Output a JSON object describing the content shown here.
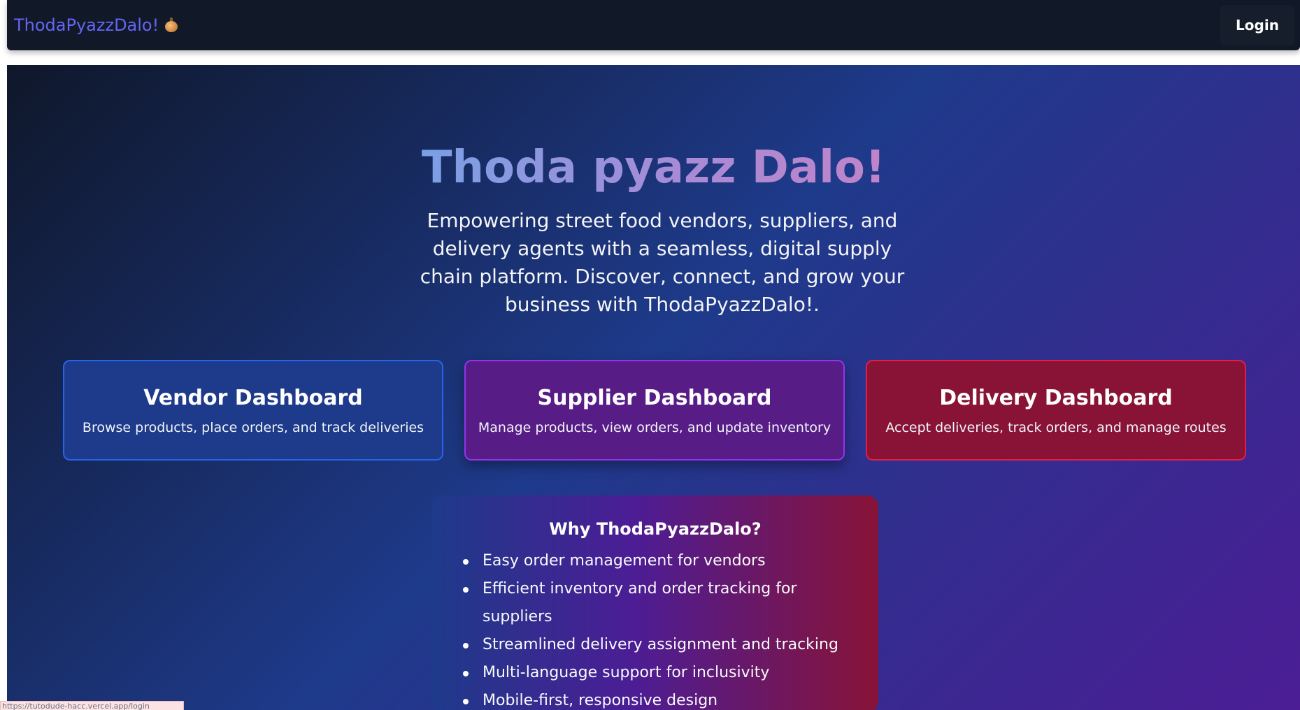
{
  "navbar": {
    "brand": "ThodaPyazzDalo!",
    "brand_icon": "onion-icon",
    "login_label": "Login"
  },
  "hero": {
    "title": "Thoda pyazz Dalo!",
    "subtitle": "Empowering street food vendors, suppliers, and delivery agents with a seamless, digital supply chain platform. Discover, connect, and grow your business with ThodaPyazzDalo!."
  },
  "cards": [
    {
      "title": "Vendor Dashboard",
      "description": "Browse products, place orders, and track deliveries",
      "color": "#1e3a8a"
    },
    {
      "title": "Supplier Dashboard",
      "description": "Manage products, view orders, and update inventory",
      "color": "#581c87"
    },
    {
      "title": "Delivery Dashboard",
      "description": "Accept deliveries, track orders, and manage routes",
      "color": "#881337"
    }
  ],
  "why": {
    "title": "Why ThodaPyazzDalo?",
    "items": [
      "Easy order management for vendors",
      "Efficient inventory and order tracking for suppliers",
      "Streamlined delivery assignment and tracking",
      "Multi-language support for inclusivity",
      "Mobile-first, responsive design"
    ]
  },
  "status_bar": {
    "url": "https://tutodude-hacc.vercel.app/login"
  },
  "colors": {
    "brand": "#6366f1",
    "navbar_bg": "#111827"
  }
}
